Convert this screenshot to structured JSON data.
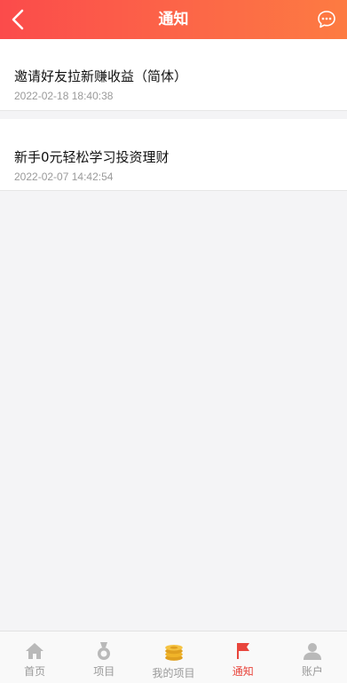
{
  "header": {
    "title": "通知"
  },
  "notices": [
    {
      "title": "邀请好友拉新赚收益（简体）",
      "time": "2022-02-18 18:40:38"
    },
    {
      "title": "新手0元轻松学习投资理财",
      "time": "2022-02-07 14:42:54"
    }
  ],
  "tabbar": {
    "items": [
      {
        "label": "首页",
        "icon": "home-icon"
      },
      {
        "label": "项目",
        "icon": "medal-icon"
      },
      {
        "label": "我的项目",
        "icon": "coins-icon"
      },
      {
        "label": "通知",
        "icon": "flag-icon"
      },
      {
        "label": "账户",
        "icon": "person-icon"
      }
    ],
    "active": "通知"
  },
  "colors": {
    "header_gradient_start": "#fb4b4b",
    "header_gradient_end": "#fd7b42",
    "active_tab": "#e8453c",
    "inactive_tab": "#999999"
  }
}
